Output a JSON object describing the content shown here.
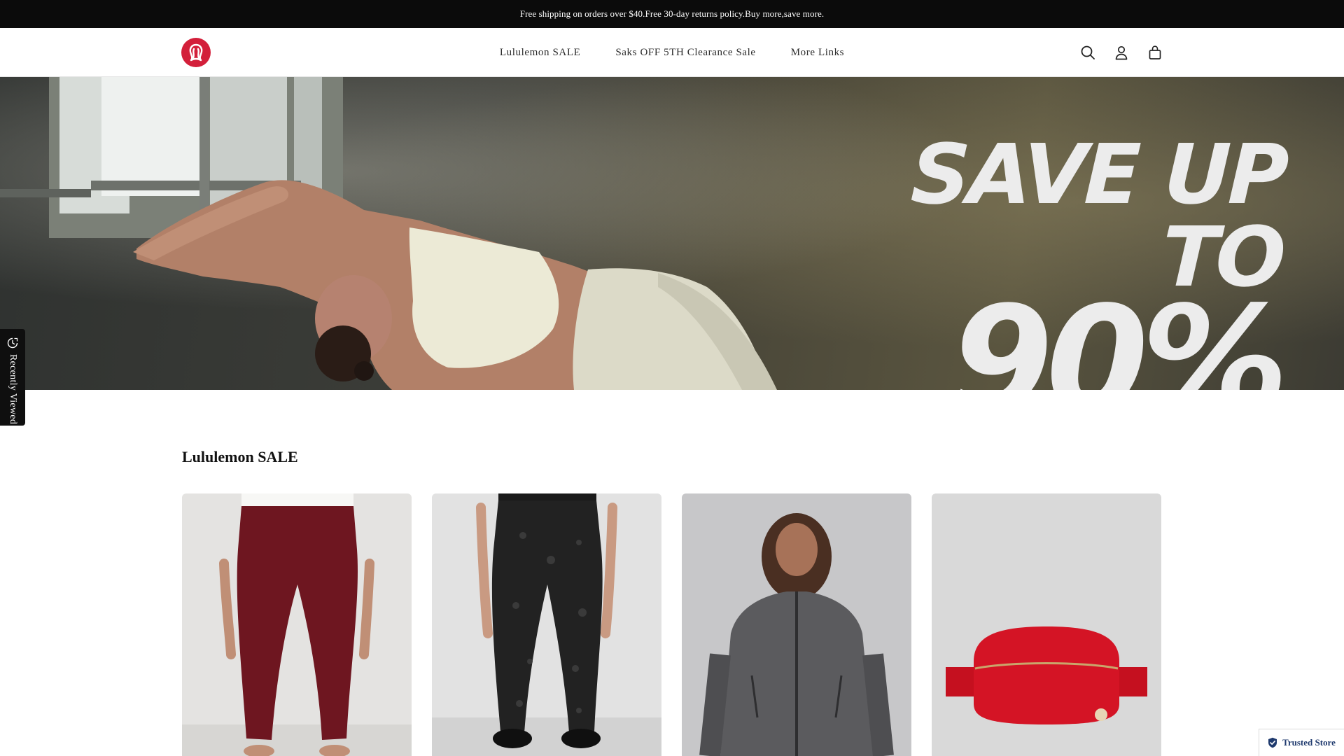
{
  "announcement": {
    "text": "Free shipping on orders over $40.Free 30-day returns policy.Buy more,save more."
  },
  "header": {
    "logo_icon": "lululemon-logo-icon",
    "brand_color": "#d31f3a",
    "nav": [
      {
        "label": "Lululemon SALE"
      },
      {
        "label": "Saks OFF 5TH Clearance Sale"
      },
      {
        "label": "More Links"
      }
    ],
    "icons": [
      "search-icon",
      "account-icon",
      "cart-icon"
    ]
  },
  "hero": {
    "line1": "SAVE UP TO",
    "line2": "90%"
  },
  "recently_viewed": {
    "label": "Recently Viewed",
    "icon": "recently-viewed-icon"
  },
  "section": {
    "title": "Lululemon SALE",
    "products": [
      {
        "name": "burgundy-leggings",
        "color": "#6e1620"
      },
      {
        "name": "black-pattern-leggings",
        "color": "#1e1e1e"
      },
      {
        "name": "grey-define-jacket",
        "color": "#5b5b5e"
      },
      {
        "name": "red-belt-bag",
        "color": "#d41425"
      }
    ]
  },
  "trusted_badge": {
    "label": "Trusted Store",
    "icon": "shield-check-icon"
  }
}
